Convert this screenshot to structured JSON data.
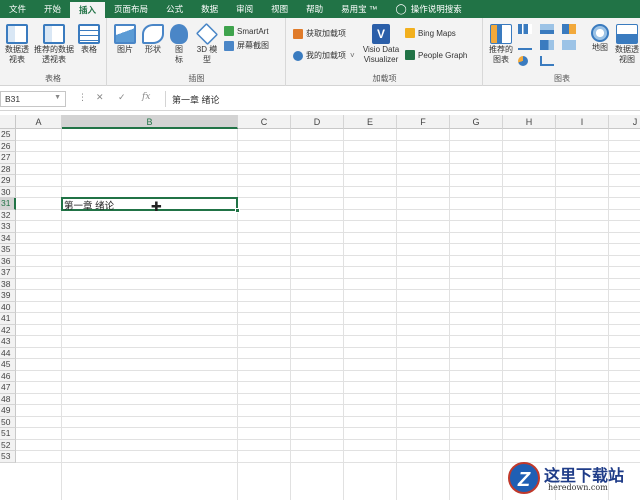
{
  "tabs": [
    "文件",
    "开始",
    "插入",
    "页面布局",
    "公式",
    "数据",
    "审阅",
    "视图",
    "帮助",
    "易用宝 ™",
    "操作说明搜索"
  ],
  "active_tab": "插入",
  "ribbon": {
    "tables": {
      "label": "表格",
      "pivot_table": "数据透视表",
      "recommended_pivot": "推荐的数据透视表",
      "table": "表格"
    },
    "illustrations": {
      "label": "插图",
      "pictures": "图片",
      "shapes": "形状",
      "icons": "图标",
      "model3d": "3D 模型",
      "smartart": "SmartArt",
      "screenshot": "屏幕截图"
    },
    "addins": {
      "label": "加载项",
      "get_addins": "获取加载项",
      "my_addins": "我的加载项",
      "visio": "Visio Data Visualizer",
      "bing_maps": "Bing Maps",
      "people_graph": "People Graph"
    },
    "charts": {
      "label": "图表",
      "recommended": "推荐的图表",
      "maps": "地图",
      "pivot_chart": "数据透视图"
    }
  },
  "formula_bar": {
    "name_box": "B31",
    "fx": "fx",
    "content": "第一章 绪论"
  },
  "columns": [
    "A",
    "B",
    "C",
    "D",
    "E",
    "F",
    "G",
    "H",
    "I",
    "J"
  ],
  "selected_column": "B",
  "rows": [
    "25",
    "26",
    "27",
    "28",
    "29",
    "30",
    "31",
    "32",
    "33",
    "34",
    "35",
    "36",
    "37",
    "38",
    "39",
    "40",
    "41",
    "42",
    "43",
    "44",
    "45",
    "46",
    "47",
    "48",
    "49",
    "50",
    "51",
    "52",
    "53"
  ],
  "selected_row": "31",
  "active_cell": {
    "ref": "B31",
    "value": "第一章 绪论"
  },
  "watermark": {
    "name": "这里下载站",
    "url": "heredown.com"
  },
  "colors": {
    "accent": "#217346",
    "ribbon_bg": "#f3f3f3"
  }
}
